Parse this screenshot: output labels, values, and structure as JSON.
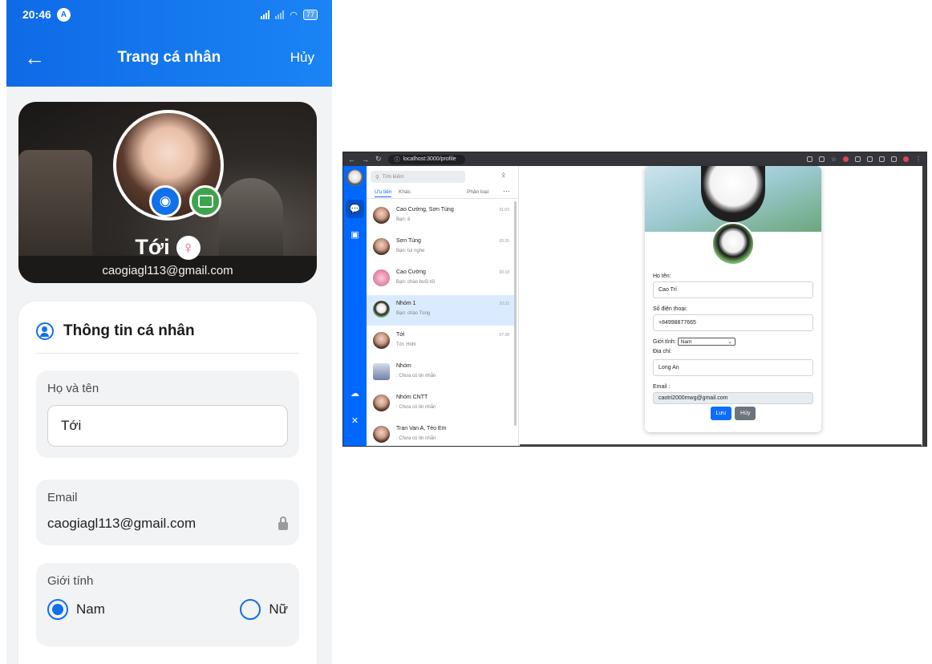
{
  "phone": {
    "status": {
      "time": "20:46",
      "battery": "77"
    },
    "appbar": {
      "title": "Trang cá nhân",
      "cancel": "Hủy"
    },
    "profile": {
      "name": "Tới",
      "email": "caogiagl113@gmail.com"
    },
    "section": {
      "title": "Thông tin cá nhân",
      "name_label": "Họ và tên",
      "name_value": "Tới",
      "email_label": "Email",
      "email_value": "caogiagl113@gmail.com",
      "gender_label": "Giới tính",
      "gender_male": "Nam",
      "gender_female": "Nữ",
      "gender_selected": "Nam"
    }
  },
  "browser": {
    "url": "localhost:3000/profile",
    "search_placeholder": "Tìm kiếm",
    "tabs": {
      "priority": "Ưu tiên",
      "other": "Khác",
      "classify": "Phân loại",
      "more": "···"
    },
    "conversations": [
      {
        "name": "Cao Cường, Sơn Tùng",
        "message": "Bạn: ê",
        "time": "01:09"
      },
      {
        "name": "Sơn Tùng",
        "message": "Bạn: tui nghe",
        "time": "00:35"
      },
      {
        "name": "Cao Cường",
        "message": "Bạn: chào buổi tối",
        "time": "00:18"
      },
      {
        "name": "Nhóm 1",
        "message": "Bạn: chào Tùng",
        "time": "20:32",
        "selected": true
      },
      {
        "name": "Tới",
        "message": "Tới: Hohi",
        "time": "07:38"
      },
      {
        "name": "Nhóm",
        "message": ": Chưa có tin nhắn",
        "time": ""
      },
      {
        "name": "Nhóm CNTT",
        "message": ": Chưa có tin nhắn",
        "time": ""
      },
      {
        "name": "Tran Van A, Tèo Em",
        "message": ": Chưa có tin nhắn",
        "time": ""
      }
    ],
    "form": {
      "name_label": "Họ tên:",
      "name_value": "Cao Trí",
      "phone_label": "Số điện thoại:",
      "phone_value": "+84998877665",
      "gender_label": "Giới tính:",
      "gender_value": "Nam",
      "address_label": "Địa chỉ:",
      "address_value": "Long An",
      "email_label": "Email :",
      "email_value": "caotri2000mwg@gmail.com",
      "save": "Lưu",
      "cancel": "Hủy"
    }
  }
}
